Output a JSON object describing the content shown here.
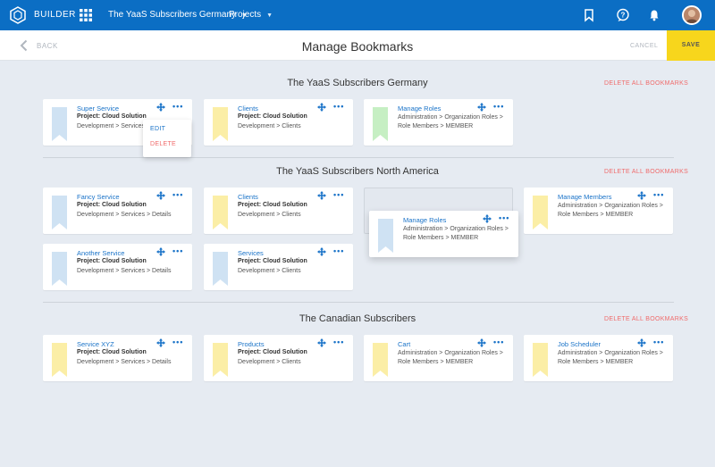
{
  "topbar": {
    "brand": "BUILDER",
    "project_selector": "The YaaS Subscribers Germany",
    "projects_menu": "Projects",
    "icons": [
      "bookmark-icon",
      "help-chat-icon",
      "bell-icon"
    ],
    "accent": "#0b6ec4"
  },
  "actionbar": {
    "back_label": "BACK",
    "title": "Manage Bookmarks",
    "cancel_label": "CANCEL",
    "save_label": "SAVE",
    "save_color": "#f7d61c"
  },
  "delete_all_label": "DELETE ALL BOOKMARKS",
  "menu": {
    "edit_label": "EDIT",
    "delete_label": "DELETE"
  },
  "sections": [
    {
      "title": "The YaaS Subscribers Germany",
      "cards": [
        {
          "title": "Super Service",
          "project": "Project: Cloud Solution",
          "path": "Development > Services > Details",
          "flag": "#cfe2f3"
        },
        {
          "title": "Clients",
          "project": "Project: Cloud Solution",
          "path": "Development > Clients",
          "flag": "#fbeea6"
        },
        {
          "title": "Manage Roles",
          "project": "",
          "path": "Administration > Organization Roles > Role Members > MEMBER",
          "flag": "#c6efc3"
        }
      ]
    },
    {
      "title": "The YaaS Subscribers North America",
      "cards": [
        {
          "title": "Fancy Service",
          "project": "Project: Cloud Solution",
          "path": "Development > Services > Details",
          "flag": "#cfe2f3"
        },
        {
          "title": "Clients",
          "project": "Project: Cloud Solution",
          "path": "Development > Clients",
          "flag": "#fbeea6"
        },
        {
          "title": "Manage Roles",
          "project": "",
          "path": "Administration > Organization Roles > Role Members > MEMBER",
          "flag": "#cfe2f3"
        },
        {
          "title": "Manage Members",
          "project": "",
          "path": "Administration > Organization Roles > Role Members > MEMBER",
          "flag": "#fbeea6"
        },
        {
          "title": "Another Service",
          "project": "Project: Cloud Solution",
          "path": "Development > Services > Details",
          "flag": "#cfe2f3"
        },
        {
          "title": "Services",
          "project": "Project: Cloud Solution",
          "path": "Development > Clients",
          "flag": "#cfe2f3"
        }
      ]
    },
    {
      "title": "The Canadian Subscribers",
      "cards": [
        {
          "title": "Service XYZ",
          "project": "Project: Cloud Solution",
          "path": "Development > Services > Details",
          "flag": "#fbeea6"
        },
        {
          "title": "Products",
          "project": "Project: Cloud Solution",
          "path": "Development > Clients",
          "flag": "#fbeea6"
        },
        {
          "title": "Cart",
          "project": "",
          "path": "Administration > Organization Roles > Role Members > MEMBER",
          "flag": "#fbeea6"
        },
        {
          "title": "Job Scheduler",
          "project": "",
          "path": "Administration > Organization Roles > Role Members > MEMBER",
          "flag": "#fbeea6"
        }
      ]
    }
  ]
}
